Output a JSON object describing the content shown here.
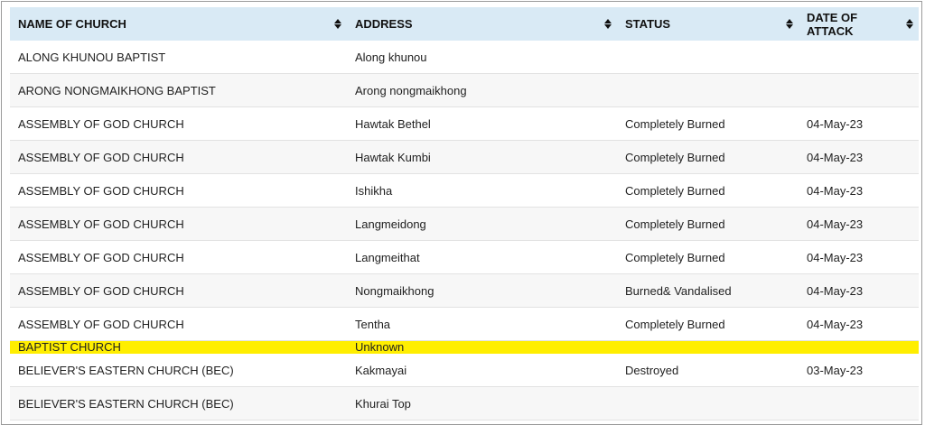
{
  "table": {
    "columns": [
      {
        "label": "NAME OF CHURCH",
        "sort_icon": "sort-icon"
      },
      {
        "label": "ADDRESS",
        "sort_icon": "sort-icon"
      },
      {
        "label": "STATUS",
        "sort_icon": "sort-icon"
      },
      {
        "label": "DATE OF ATTACK",
        "sort_icon": "sort-icon"
      }
    ],
    "rows": [
      {
        "name": "ALONG KHUNOU BAPTIST",
        "address": "Along khunou",
        "status": "",
        "date": ""
      },
      {
        "name": "ARONG NONGMAIKHONG BAPTIST",
        "address": "Arong nongmaikhong",
        "status": "",
        "date": ""
      },
      {
        "name": "ASSEMBLY OF GOD CHURCH",
        "address": "Hawtak Bethel",
        "status": "Completely Burned",
        "date": "04-May-23"
      },
      {
        "name": "ASSEMBLY OF GOD CHURCH",
        "address": "Hawtak Kumbi",
        "status": "Completely Burned",
        "date": "04-May-23"
      },
      {
        "name": "ASSEMBLY OF GOD CHURCH",
        "address": "Ishikha",
        "status": "Completely Burned",
        "date": "04-May-23"
      },
      {
        "name": "ASSEMBLY OF GOD CHURCH",
        "address": "Langmeidong",
        "status": "Completely Burned",
        "date": "04-May-23"
      },
      {
        "name": "ASSEMBLY OF GOD CHURCH",
        "address": "Langmeithat",
        "status": "Completely Burned",
        "date": "04-May-23"
      },
      {
        "name": "ASSEMBLY OF GOD CHURCH",
        "address": "Nongmaikhong",
        "status": "Burned& Vandalised",
        "date": "04-May-23"
      },
      {
        "name": "ASSEMBLY OF GOD CHURCH",
        "address": "Tentha",
        "status": "Completely Burned",
        "date": "04-May-23"
      },
      {
        "name": "BAPTIST CHURCH",
        "address": "Unknown",
        "status": "",
        "date": "",
        "highlighted": true
      },
      {
        "name": "BELIEVER'S EASTERN CHURCH (BEC)",
        "address": "Kakmayai",
        "status": "Destroyed",
        "date": "03-May-23"
      },
      {
        "name": "BELIEVER'S EASTERN CHURCH (BEC)",
        "address": "Khurai Top",
        "status": "",
        "date": ""
      }
    ],
    "highlight_color": "#ffee00",
    "header_color": "#d9eaf5"
  }
}
